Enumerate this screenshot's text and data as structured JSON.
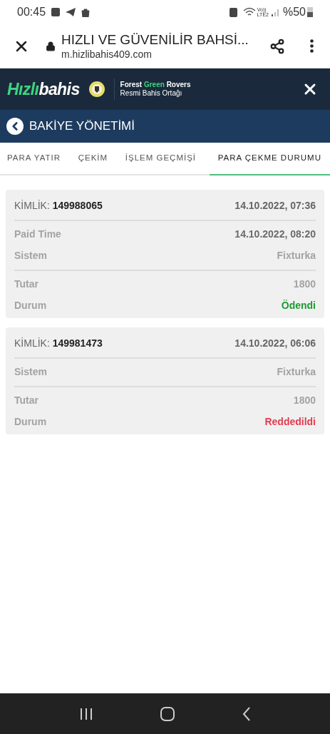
{
  "status_bar": {
    "time": "00:45",
    "volte_top": "Vo))",
    "volte_bottom": "LTE2",
    "battery": "%50"
  },
  "browser": {
    "title": "HIZLI VE GÜVENİLİR BAHSİ...",
    "url": "m.hizlibahis409.com"
  },
  "site_header": {
    "logo_first": "Hızlı",
    "logo_second": "bahis",
    "partner_parts": [
      {
        "text": "Forest ",
        "kind": "plain"
      },
      {
        "text": "Green",
        "kind": "accent"
      },
      {
        "text": " Rovers",
        "kind": "plain"
      }
    ],
    "partner_subtitle": "Resmi Bahis Ortağı"
  },
  "section": {
    "title": "BAKİYE YÖNETİMİ"
  },
  "tabs": [
    {
      "label": "PARA YATIR",
      "selected": false
    },
    {
      "label": "ÇEKİM",
      "selected": false
    },
    {
      "label": "İŞLEM GEÇMİŞİ",
      "selected": false
    },
    {
      "label": "PARA ÇEKME DURUMU",
      "selected": true
    }
  ],
  "cards": [
    {
      "id_label": "KİMLİK:",
      "id": "149988065",
      "date": "14.10.2022, 07:36",
      "groups": [
        [
          {
            "label": "Paid Time",
            "value": "14.10.2022, 08:20",
            "kind": "date"
          },
          {
            "label": "Sistem",
            "value": "Fixturka",
            "kind": "text"
          }
        ],
        [
          {
            "label": "Tutar",
            "value": "1800",
            "kind": "text"
          },
          {
            "label": "Durum",
            "value": "Ödendi",
            "kind": "status",
            "color": "#1e9a32"
          }
        ]
      ]
    },
    {
      "id_label": "KİMLİK:",
      "id": "149981473",
      "date": "14.10.2022, 06:06",
      "groups": [
        [
          {
            "label": "Sistem",
            "value": "Fixturka",
            "kind": "text"
          }
        ],
        [
          {
            "label": "Tutar",
            "value": "1800",
            "kind": "text"
          },
          {
            "label": "Durum",
            "value": "Reddedildi",
            "kind": "status",
            "color": "#e23c4f"
          }
        ]
      ]
    }
  ]
}
